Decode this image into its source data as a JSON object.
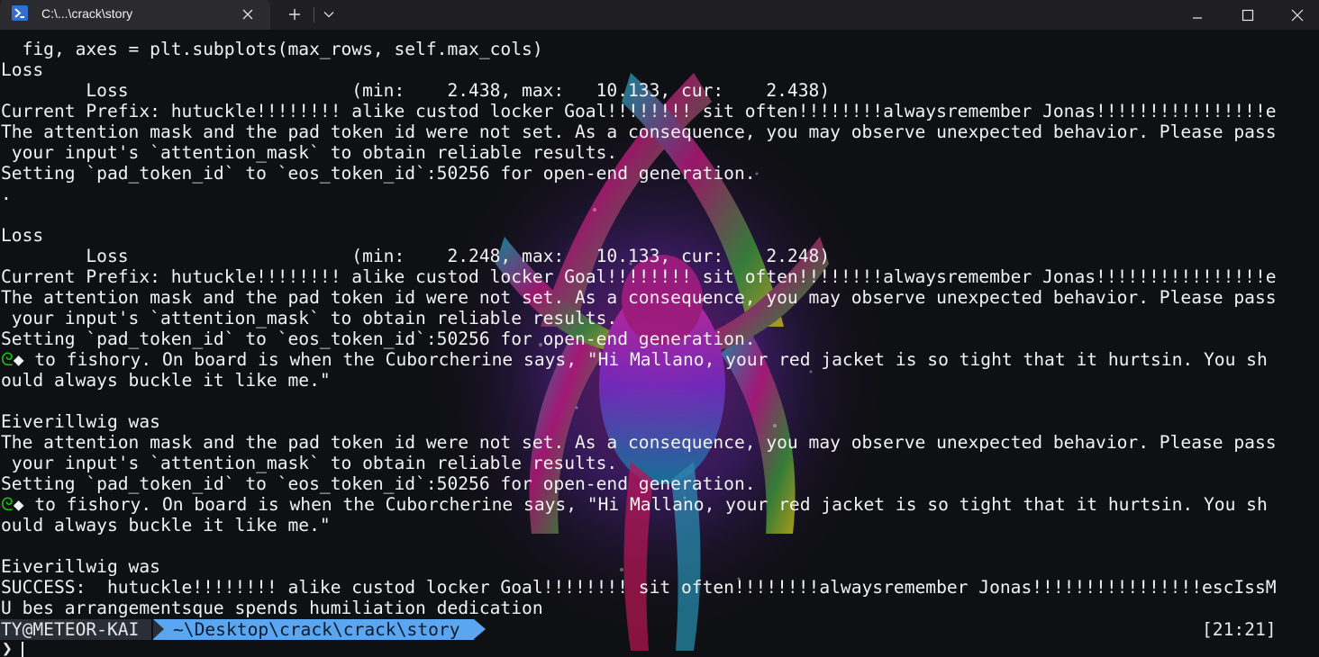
{
  "window": {
    "tab_title": "C:\\...\\crack\\story",
    "tab_icon": "powershell-icon",
    "close_tab_glyph": "✕",
    "new_tab_glyph": "+",
    "dropdown_glyph": "⌄",
    "minimize_glyph": "—",
    "maximize_glyph": "☐",
    "close_glyph": "✕"
  },
  "terminal": {
    "lines": [
      "  fig, axes = plt.subplots(max_rows, self.max_cols)",
      "Loss",
      "        Loss                     (min:    2.438, max:   10.133, cur:    2.438)",
      "Current Prefix: hutuckle!!!!!!!! alike custod locker Goal!!!!!!!! sit often!!!!!!!!alwaysremember Jonas!!!!!!!!!!!!!!!!e",
      "The attention mask and the pad token id were not set. As a consequence, you may observe unexpected behavior. Please pass",
      " your input's `attention_mask` to obtain reliable results.",
      "Setting `pad_token_id` to `eos_token_id`:50256 for open-end generation.",
      ".",
      "",
      "Loss",
      "        Loss                     (min:    2.248, max:   10.133, cur:    2.248)",
      "Current Prefix: hutuckle!!!!!!!! alike custod locker Goal!!!!!!!! sit often!!!!!!!!alwaysremember Jonas!!!!!!!!!!!!!!!!e",
      "The attention mask and the pad token id were not set. As a consequence, you may observe unexpected behavior. Please pass",
      " your input's `attention_mask` to obtain reliable results.",
      "Setting `pad_token_id` to `eos_token_id`:50256 for open-end generation.",
      "◈ to fishory. On board is when the Cuborcherine says, \"Hi Mallano, your red jacket is so tight that it hurtsin. You sh",
      "ould always buckle it like me.\"",
      "",
      "Eiverillwig was",
      "The attention mask and the pad token id were not set. As a consequence, you may observe unexpected behavior. Please pass",
      " your input's `attention_mask` to obtain reliable results.",
      "Setting `pad_token_id` to `eos_token_id`:50256 for open-end generation.",
      "◈ to fishory. On board is when the Cuborcherine says, \"Hi Mallano, your red jacket is so tight that it hurtsin. You sh",
      "ould always buckle it like me.\"",
      "",
      "Eiverillwig was",
      "SUCCESS:  hutuckle!!!!!!!! alike custod locker Goal!!!!!!!! sit often!!!!!!!!alwaysremember Jonas!!!!!!!!!!!!!!!!escIssM",
      "U bes arrangementsque spends humiliation dedication"
    ],
    "glyph_prefix": "ᘓ",
    "glyph_color": "#16c60c"
  },
  "prompt": {
    "user": "TY@METEOR-KAI",
    "path": "~\\Desktop\\crack\\crack\\story",
    "time": "[21:21]",
    "chevron": "❯",
    "user_bg": "#2a2e37",
    "path_bg": "#5aa6f0"
  }
}
